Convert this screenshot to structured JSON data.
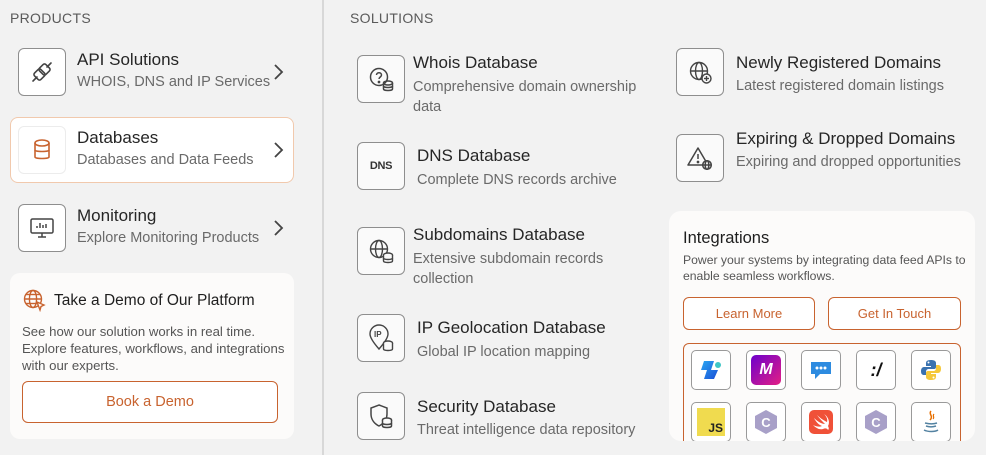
{
  "products": {
    "heading": "PRODUCTS",
    "items": [
      {
        "title": "API Solutions",
        "subtitle": "WHOIS, DNS and IP Services",
        "icon": "plug-icon"
      },
      {
        "title": "Databases",
        "subtitle": "Databases and Data Feeds",
        "icon": "database-icon"
      },
      {
        "title": "Monitoring",
        "subtitle": "Explore Monitoring Products",
        "icon": "monitor-icon"
      }
    ],
    "demo": {
      "title": "Take a Demo of Our Platform",
      "text": "See how our solution works in real time. Explore features, workflows, and integrations with our experts.",
      "button": "Book a Demo"
    }
  },
  "solutions": {
    "heading": "SOLUTIONS",
    "items": [
      {
        "title": "Whois Database",
        "subtitle": "Comprehensive domain ownership data",
        "icon": "whois-database-icon"
      },
      {
        "title": "DNS Database",
        "subtitle": "Complete DNS records archive",
        "icon": "dns-icon",
        "icon_text": "DNS"
      },
      {
        "title": "Subdomains Database",
        "subtitle": "Extensive subdomain records collection",
        "icon": "globe-database-icon"
      },
      {
        "title": "IP Geolocation Database",
        "subtitle": "Global IP location mapping",
        "icon": "ip-location-icon",
        "icon_text": "IP"
      },
      {
        "title": "Security Database",
        "subtitle": "Threat intelligence data repository",
        "icon": "shield-database-icon"
      },
      {
        "title": "Newly Registered Domains",
        "subtitle": "Latest registered domain listings",
        "icon": "globe-plus-icon"
      },
      {
        "title": "Expiring & Dropped Domains",
        "subtitle": "Expiring and dropped opportunities",
        "icon": "warning-globe-icon"
      }
    ]
  },
  "integrations": {
    "title": "Integrations",
    "text": "Power your systems by integrating data feed APIs to enable seamless workflows.",
    "learn_more": "Learn More",
    "get_in_touch": "Get In Touch",
    "logos": [
      {
        "name": "copilot-icon"
      },
      {
        "name": "make-icon",
        "text": "M"
      },
      {
        "name": "chat-icon"
      },
      {
        "name": "slash-icon",
        "text": ":/"
      },
      {
        "name": "python-icon"
      },
      {
        "name": "javascript-icon",
        "text": "JS"
      },
      {
        "name": "c-language-icon",
        "text": "C"
      },
      {
        "name": "swift-icon"
      },
      {
        "name": "c-language-icon-2",
        "text": "C"
      },
      {
        "name": "java-icon"
      }
    ]
  },
  "colors": {
    "accent": "#c8632f",
    "background": "#f2f2f2"
  }
}
